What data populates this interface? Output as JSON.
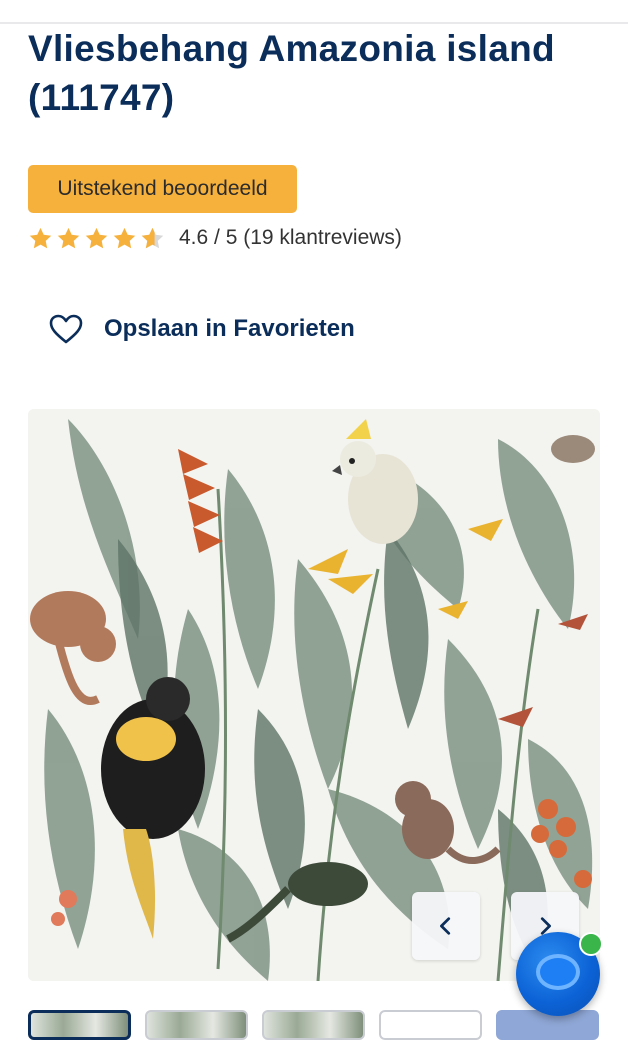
{
  "product": {
    "title": "Vliesbehang Amazonia island (111747)",
    "badge": "Uitstekend beoordeeld",
    "rating_text": "4.6 / 5 (19 klantreviews)",
    "rating_value": 4.6,
    "rating_max": 5
  },
  "favorite": {
    "label": "Opslaan in Favorieten",
    "icon": "heart-outline-icon"
  },
  "gallery": {
    "image_alt": "Vliesbehang Amazonia island",
    "prev_icon": "chevron-left-icon",
    "next_icon": "chevron-right-icon",
    "thumbnail_count": 5,
    "active_thumbnail": 1
  },
  "chat": {
    "icon": "chat-bubble-icon",
    "status": "online"
  },
  "colors": {
    "title": "#0b2d5a",
    "badge_bg": "#f6b13d",
    "star": "#f6b13d",
    "star_empty": "#d8d8d8",
    "chat_accent": "#0c63d6",
    "online": "#39b54a"
  }
}
